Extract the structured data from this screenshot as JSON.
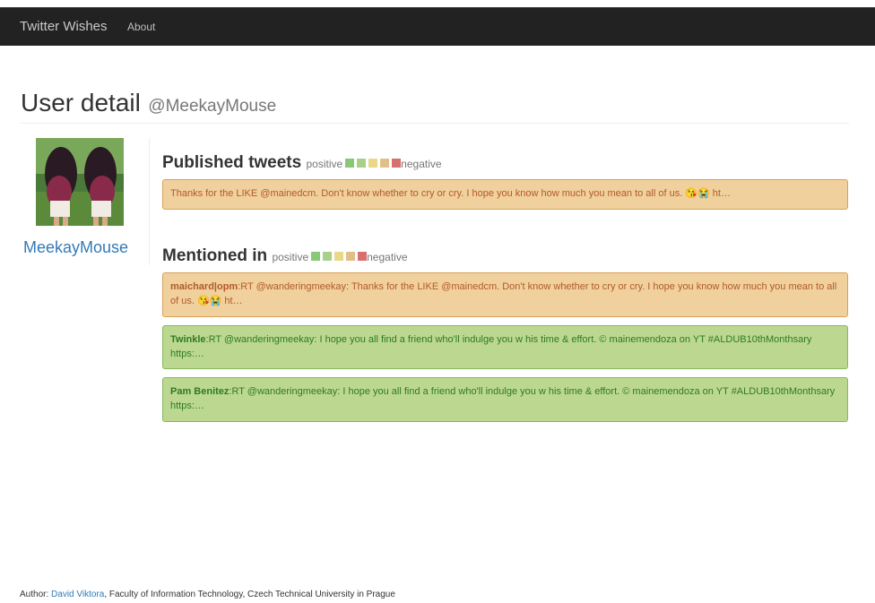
{
  "navbar": {
    "brand": "Twitter Wishes",
    "about": "About"
  },
  "header": {
    "title": "User detail",
    "handle": "@MeekayMouse"
  },
  "user": {
    "name": "MeekayMouse"
  },
  "legend": {
    "positive": "positive",
    "negative": "negative",
    "colors": [
      "#88c878",
      "#a8d088",
      "#e8d888",
      "#e0c088",
      "#d87070"
    ]
  },
  "published": {
    "title": "Published tweets",
    "tweets": [
      {
        "text": "Thanks for the LIKE @mainedcm. Don't know whether to cry or cry. I hope you know how much you mean to all of us. 😘😭 ht…",
        "sentiment": "neutral"
      }
    ]
  },
  "mentioned": {
    "title": "Mentioned in",
    "tweets": [
      {
        "author": "maichard|opm",
        "text": ":RT @wanderingmeekay: Thanks for the LIKE @mainedcm. Don't know whether to cry or cry. I hope you know how much you mean to all of us. 😘😭 ht…",
        "sentiment": "neutral"
      },
      {
        "author": "Twinkle",
        "text": ":RT @wanderingmeekay: I hope you all find a friend who'll indulge you w his time & effort. © mainemendoza on YT #ALDUB10thMonthsary https:…",
        "sentiment": "positive"
      },
      {
        "author": "Pam Benitez",
        "text": ":RT @wanderingmeekay: I hope you all find a friend who'll indulge you w his time & effort. © mainemendoza on YT #ALDUB10thMonthsary https:…",
        "sentiment": "positive"
      }
    ]
  },
  "footer": {
    "prefix": "Author: ",
    "author_link": "David Viktora",
    "suffix": ", Faculty of Information Technology, Czech Technical University in Prague"
  }
}
